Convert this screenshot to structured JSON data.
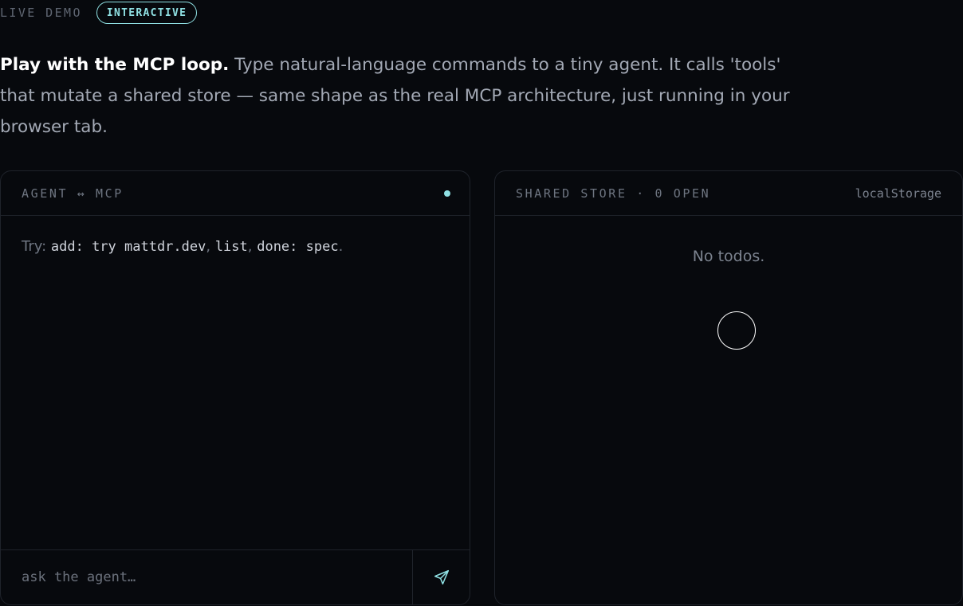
{
  "header": {
    "eyebrow": "LIVE DEMO",
    "badge": "INTERACTIVE"
  },
  "intro": {
    "lead": "Play with the MCP loop.",
    "body": " Type natural-language commands to a tiny agent. It calls 'tools' that mutate a shared store — same shape as the real MCP architecture, just running in your browser tab."
  },
  "agent_panel": {
    "title": "AGENT ↔ MCP",
    "hint": {
      "prefix": "Try: ",
      "cmd1": "add: try mattdr.dev",
      "sep1": ", ",
      "cmd2": "list",
      "sep2": ", ",
      "cmd3": "done: spec",
      "suffix": "."
    },
    "input": {
      "value": "",
      "placeholder": "ask the agent…"
    },
    "send_icon": "send-icon"
  },
  "store_panel": {
    "title": "SHARED STORE · 0 OPEN",
    "storage": "localStorage",
    "empty_text": "No todos."
  },
  "colors": {
    "accent": "#8fe0e3",
    "background": "#07090d",
    "border": "#1f232b"
  }
}
